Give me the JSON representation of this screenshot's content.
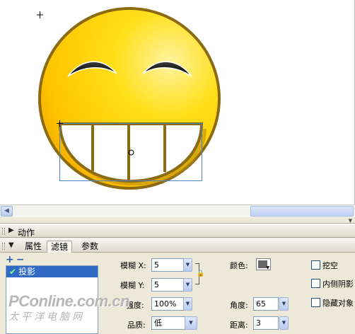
{
  "stage": {
    "face_fill": "#ffd800",
    "face_stroke": "#8b6a12",
    "selection_color": "#4a87c6"
  },
  "panels": {
    "actions_title": "动作",
    "tabs": [
      "属性",
      "滤镜",
      "参数"
    ],
    "active_tab": "滤镜"
  },
  "filters": {
    "add_symbol": "+",
    "remove_symbol": "−",
    "items": [
      {
        "label": "投影",
        "enabled": true,
        "selected": true
      }
    ]
  },
  "params": {
    "blur_x_label": "模糊 X:",
    "blur_x_value": "5",
    "blur_y_label": "模糊 Y:",
    "blur_y_value": "5",
    "strength_label": "强度:",
    "strength_value": "100%",
    "quality_label": "品质:",
    "quality_value": "低",
    "color_label": "颜色:",
    "color_value": "#666666",
    "angle_label": "角度:",
    "angle_value": "65",
    "distance_label": "距离:",
    "distance_value": "3",
    "knockout_label": "挖空",
    "inner_shadow_label": "内侧阴影",
    "hide_object_label": "隐藏对象"
  },
  "watermark": {
    "line1": "PConline.com.cn",
    "line2": "太平洋电脑网"
  }
}
